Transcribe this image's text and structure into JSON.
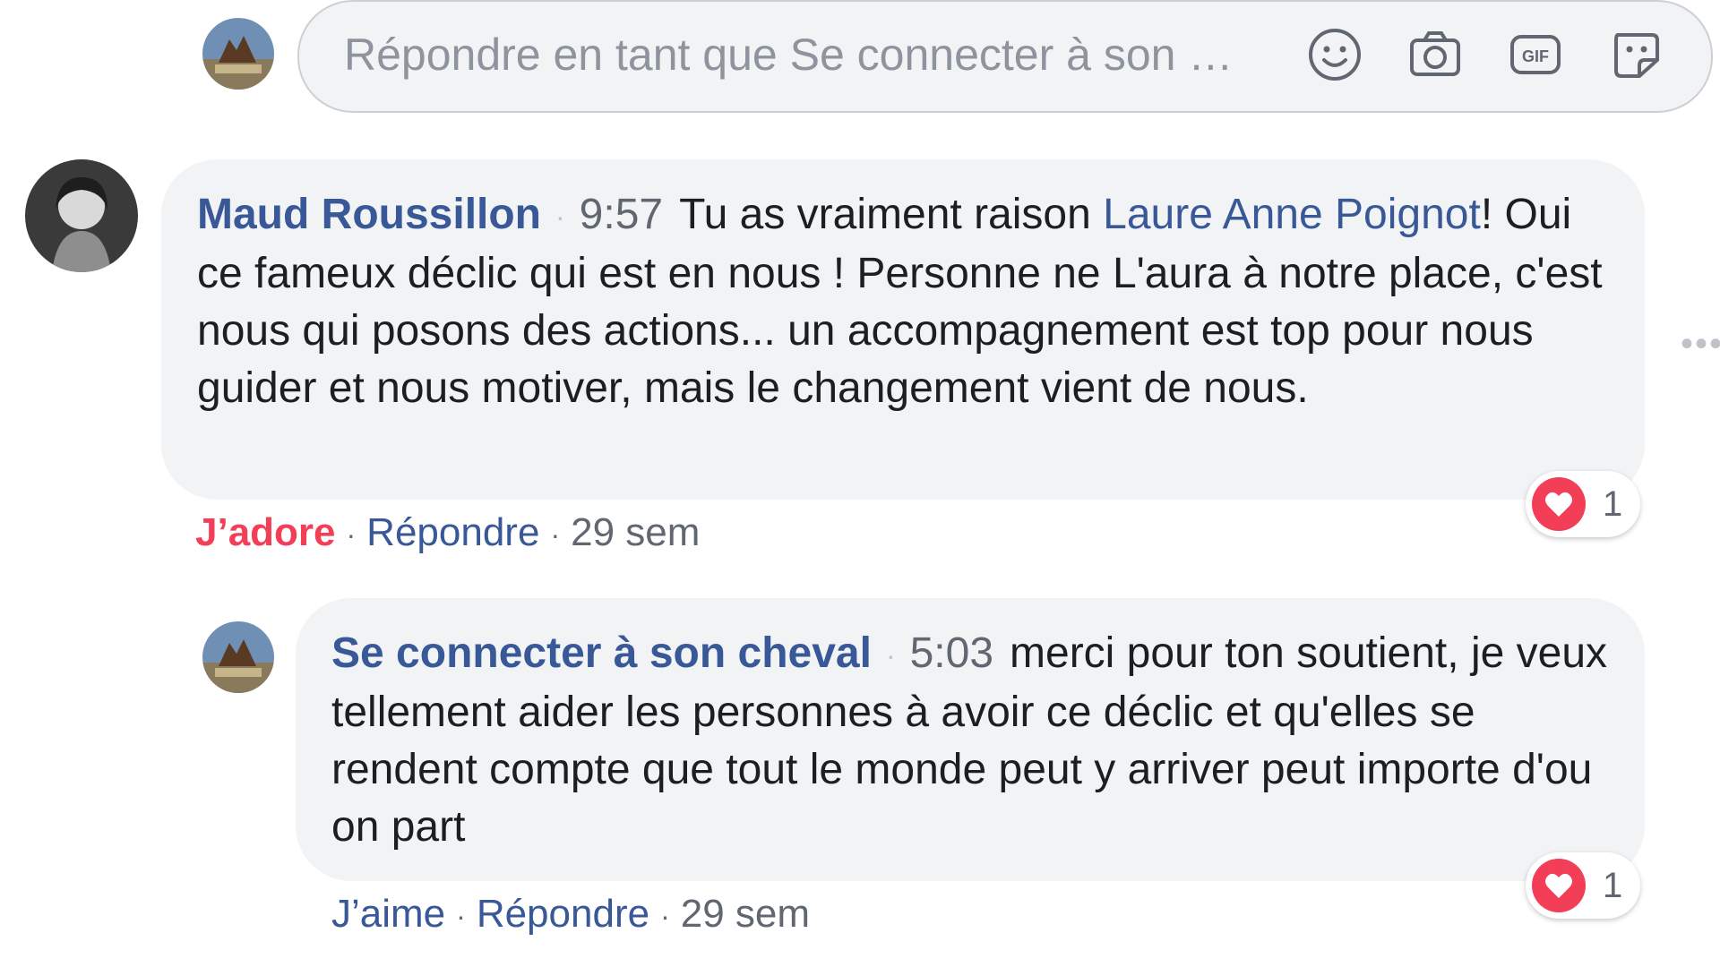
{
  "composer": {
    "placeholder": "Répondre en tant que Se connecter à son …",
    "icons": [
      "emoji-icon",
      "camera-icon",
      "gif-icon",
      "sticker-icon"
    ]
  },
  "comments": [
    {
      "author": "Maud Roussillon",
      "time": "9:57",
      "text_before": "Tu as vraiment raison ",
      "mention": "Laure Anne Poignot",
      "text_after": "! Oui ce fameux déclic qui est en nous ! Personne ne L'aura à notre place, c'est nous qui posons des actions... un accompagnement est top pour nous guider et nous motiver, mais le changement vient de nous.",
      "like_label": "J’adore",
      "reply_label": "Répondre",
      "age": "29 sem",
      "reaction_count": "1"
    },
    {
      "author": "Se connecter à son cheval",
      "time": "5:03",
      "text": "merci pour ton soutient, je veux tellement aider les personnes à avoir ce déclic et qu'elles se rendent compte que tout le monde peut y arriver peut importe d'ou on part",
      "like_label": "J’aime",
      "reply_label": "Répondre",
      "age": "29 sem",
      "reaction_count": "1"
    }
  ],
  "colors": {
    "link": "#385898",
    "love": "#f33e58",
    "bubble": "#f2f3f5",
    "meta": "#606770"
  }
}
